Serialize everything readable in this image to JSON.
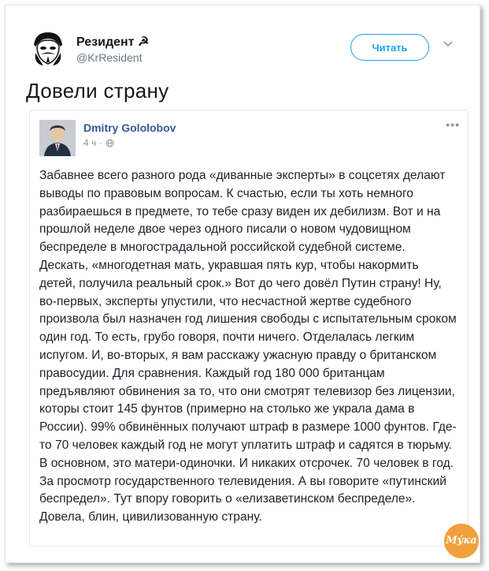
{
  "tweet": {
    "author_name": "Резидент",
    "author_symbol": "☭",
    "author_handle": "@KrResident",
    "follow_label": "Читать",
    "text": "Довели страну"
  },
  "fb_post": {
    "author_name": "Dmitry Gololobov",
    "time": "4 ч ·",
    "more_label": "•••",
    "body": "Забавнее всего разного рода «диванные эксперты» в соцсетях делают выводы по правовым вопросам. К счастью, если ты хоть немного разбираешься в предмете, то тебе сразу виден их дебилизм. Вот и на прошлой неделе двое через одного писали о новом чудовищном беспределе в многострадальной российской судебной системе. Дескать, «многодетная мать, укравшая пять кур, чтобы накормить детей, получила реальный срок.» Вот до чего довёл Путин страну! Ну, во-первых, эксперты упустили, что несчастной жертве судебного произвола был назначен год лишения свободы с испытательным сроком один год. То есть, грубо говоря, почти ничего. Отделалась легким испугом. И, во-вторых, я вам расскажу ужасную правду о британском правосудии. Для сравнения. Каждый год 180 000 британцам предъявляют обвинения за то, что они смотрят телевизор без лицензии, которы стоит 145 фунтов (примерно на столько же украла дама в России). 99% обвинённых получают штраф в размере 1000 фунтов. Где-то 70 человек каждый год не могут уплатить штраф и садятся в тюрьму. В основном, это матери-одиночки. И никаких отсрочек. 70 человек в год. За просмотр государственного телевидения. А вы говорите «путинский беспредел». Тут впору говорить о «елизаветинском беспределе». Довела, блин, цивилизованную страну."
  },
  "watermark": {
    "text": "Му́ка"
  },
  "colors": {
    "twitter_blue": "#1da1f2",
    "fb_link": "#365899",
    "logo_orange": "#f2a03d"
  },
  "icons": [
    "guy-fawkes-avatar",
    "chevron-down-icon",
    "globe-icon",
    "more-icon"
  ]
}
